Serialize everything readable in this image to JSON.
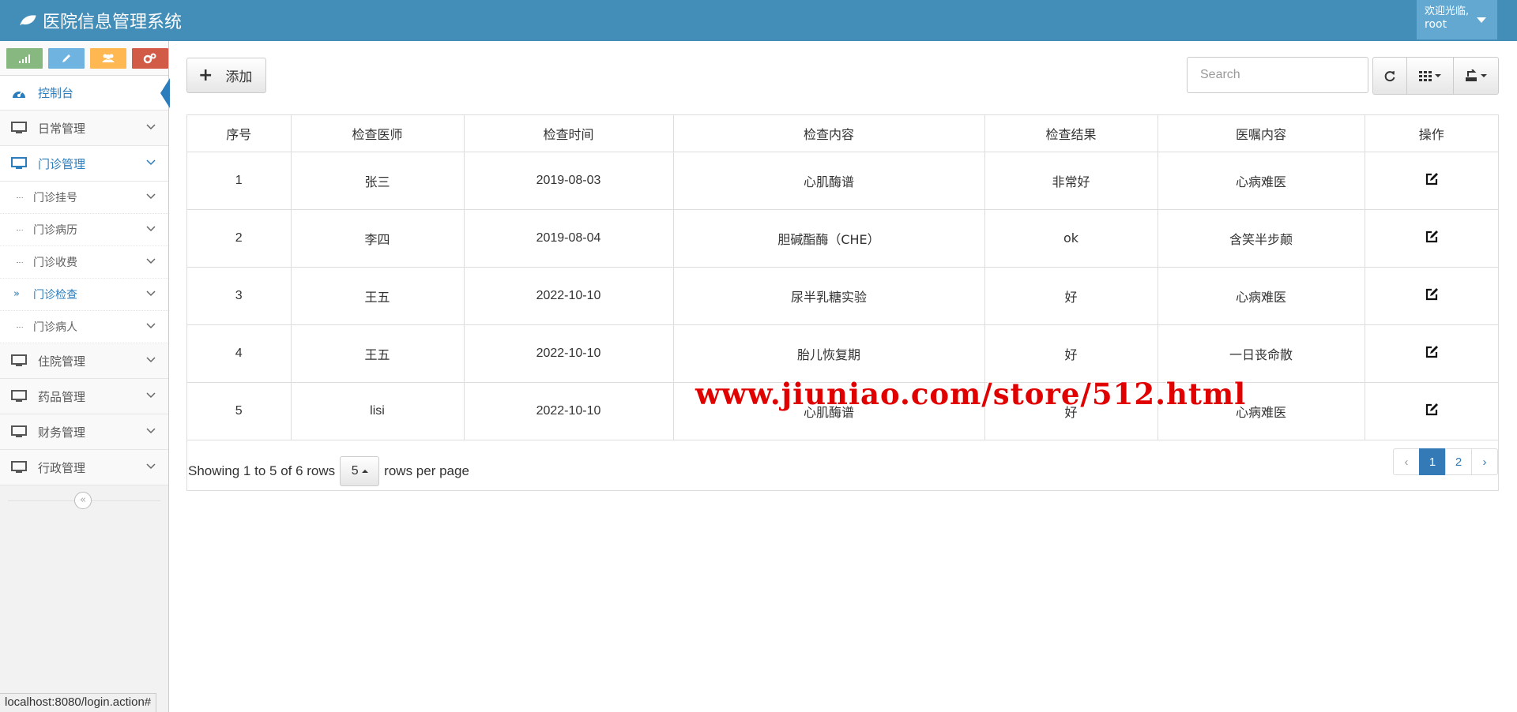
{
  "app": {
    "title": "医院信息管理系统"
  },
  "user": {
    "welcome": "欢迎光临,",
    "name": "root"
  },
  "sidebar": {
    "shortcuts": [
      {
        "icon": "signal-icon",
        "color": "#87b87f"
      },
      {
        "icon": "pencil-icon",
        "color": "#6fb3e0"
      },
      {
        "icon": "users-icon",
        "color": "#ffb752"
      },
      {
        "icon": "cogs-icon",
        "color": "#d15b47"
      }
    ],
    "dashboard": "控制台",
    "daily": "日常管理",
    "outpatient": "门诊管理",
    "sub": [
      "门诊挂号",
      "门诊病历",
      "门诊收费",
      "门诊检查",
      "门诊病人"
    ],
    "inpatient": "住院管理",
    "drugs": "药品管理",
    "finance": "财务管理",
    "admin": "行政管理"
  },
  "toolbar": {
    "add_label": "添加",
    "search_placeholder": "Search"
  },
  "table": {
    "headers": [
      "序号",
      "检查医师",
      "检查时间",
      "检查内容",
      "检查结果",
      "医嘱内容",
      "操作"
    ],
    "rows": [
      [
        "1",
        "张三",
        "2019-08-03",
        "心肌酶谱",
        "非常好",
        "心病难医"
      ],
      [
        "2",
        "李四",
        "2019-08-04",
        "胆碱酯酶（CHE）",
        "ok",
        "含笑半步颠"
      ],
      [
        "3",
        "王五",
        "2022-10-10",
        "尿半乳糖实验",
        "好",
        "心病难医"
      ],
      [
        "4",
        "王五",
        "2022-10-10",
        "胎儿恢复期",
        "好",
        "一日丧命散"
      ],
      [
        "5",
        "lisi",
        "2022-10-10",
        "心肌酶谱",
        "好",
        "心病难医"
      ]
    ]
  },
  "pagination": {
    "showing": "Showing 1 to 5 of 6 rows",
    "page_size": "5",
    "per_page": "rows per page",
    "prev": "‹",
    "pages": [
      "1",
      "2"
    ],
    "next": "›"
  },
  "watermark": "www.jiuniao.com/store/512.html",
  "status_url": "localhost:8080/login.action#"
}
